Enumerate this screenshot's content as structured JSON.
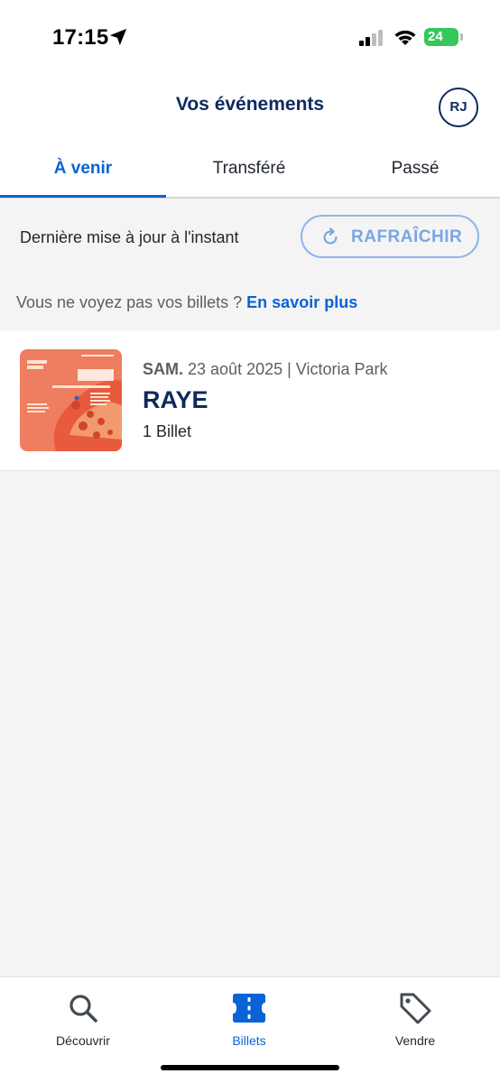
{
  "status_bar": {
    "time": "17:15",
    "battery": "24",
    "icons": [
      "location-arrow-icon",
      "cellular-signal-icon",
      "wifi-icon",
      "battery-charging-icon"
    ]
  },
  "header": {
    "title": "Vos événements",
    "avatar_initials": "RJ"
  },
  "tabs": [
    {
      "label": "À venir",
      "active": true
    },
    {
      "label": "Transféré",
      "active": false
    },
    {
      "label": "Passé",
      "active": false
    }
  ],
  "refresh": {
    "status_text": "Dernière mise à jour à l'instant",
    "button_label": "RAFRAÎCHIR",
    "icon": "refresh-icon"
  },
  "info": {
    "text": "Vous ne voyez pas vos billets ?",
    "link": "En savoir plus"
  },
  "events": [
    {
      "day": "SAM.",
      "date_venue": "23 août 2025 | Victoria Park",
      "name": "RAYE",
      "tickets": "1 Billet",
      "poster_text": {
        "festival": "ALL POINTS EAST",
        "headliner": "RAYE",
        "support": [
          "TYLA",
          "DOECHII",
          "JADE"
        ]
      }
    }
  ],
  "bottom_nav": [
    {
      "label": "Découvrir",
      "icon": "search-icon",
      "active": false
    },
    {
      "label": "Billets",
      "icon": "ticket-icon",
      "active": true
    },
    {
      "label": "Vendre",
      "icon": "tag-icon",
      "active": false
    }
  ],
  "colors": {
    "brand_navy": "#0e2a5c",
    "accent_blue": "#0a63d6",
    "refresh_blue": "#7aa6e3",
    "background": "#f4f4f4",
    "battery_green": "#34c759",
    "poster_coral": "#ef7d5f"
  }
}
